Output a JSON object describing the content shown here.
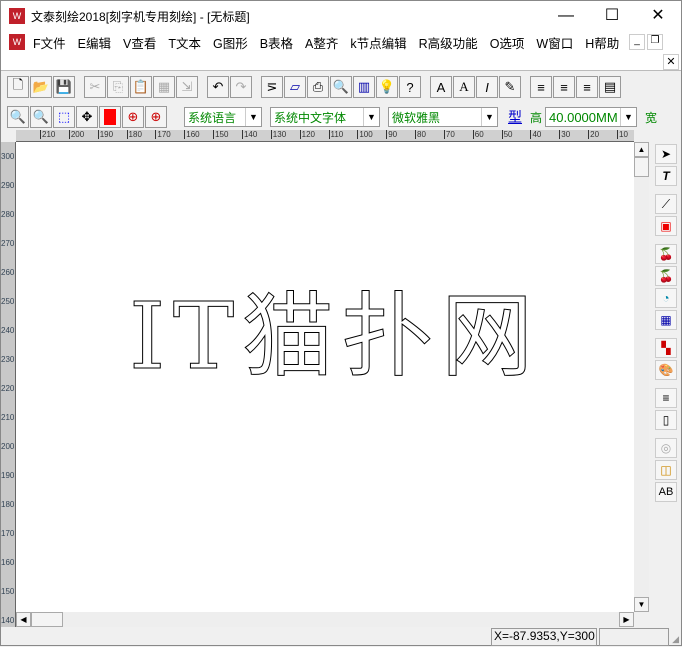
{
  "title": "文泰刻绘2018[刻字机专用刻绘] - [无标题]",
  "menu": [
    "F文件",
    "E编辑",
    "V查看",
    "T文本",
    "G图形",
    "B表格",
    "A整齐",
    "k节点编辑",
    "R高级功能",
    "O选项",
    "W窗口",
    "H帮助"
  ],
  "toolbar2": {
    "language": "系统语言",
    "cn_font": "系统中文字体",
    "font": "微软雅黑",
    "type_btn": "型",
    "height_label": "高",
    "height_value": "40.0000MM",
    "width_label": "宽"
  },
  "ruler": {
    "top": [
      "210",
      "200",
      "190",
      "180",
      "170",
      "160",
      "150",
      "140",
      "130",
      "120",
      "110",
      "100",
      "90",
      "80",
      "70",
      "60",
      "50",
      "40",
      "30",
      "20",
      "10"
    ],
    "left": [
      "300",
      "290",
      "280",
      "270",
      "260",
      "250",
      "240",
      "230",
      "220",
      "210",
      "200",
      "190",
      "180",
      "170",
      "160",
      "150",
      "140"
    ]
  },
  "canvas_text": "IT猫扑网",
  "status": {
    "coords": "X=-87.9353,Y=300"
  }
}
